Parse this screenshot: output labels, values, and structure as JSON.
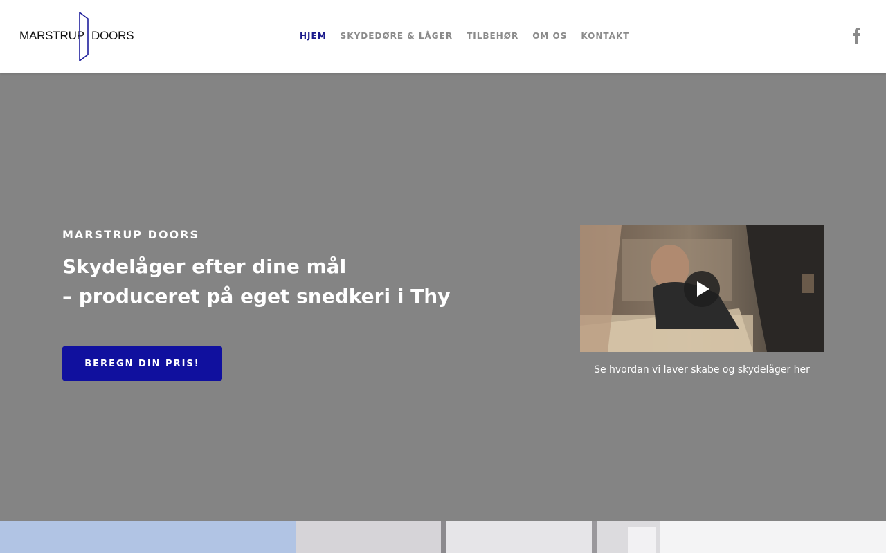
{
  "header": {
    "logo": {
      "left_text": "MARSTRUP",
      "right_text": "DOORS"
    },
    "nav": [
      {
        "label": "HJEM",
        "active": true
      },
      {
        "label": "SKYDEDØRE & LÅGER",
        "active": false
      },
      {
        "label": "TILBEHØR",
        "active": false
      },
      {
        "label": "OM OS",
        "active": false
      },
      {
        "label": "KONTAKT",
        "active": false
      }
    ],
    "social_icon": "facebook-icon"
  },
  "hero": {
    "eyebrow": "MARSTRUP DOORS",
    "headline_line1": "Skydelåger efter dine mål",
    "headline_line2": "– produceret på eget snedkeri i Thy",
    "cta_label": "BEREGN DIN PRIS!",
    "video": {
      "icon": "play-icon",
      "caption": "Se hvordan vi laver skabe og skydelåger her"
    }
  },
  "colors": {
    "accent": "#10109e",
    "nav_active": "#1a1a8c",
    "nav_inactive": "#8a8a8a",
    "hero_bg": "#848484",
    "bottom_left": "#b1c4e4"
  }
}
